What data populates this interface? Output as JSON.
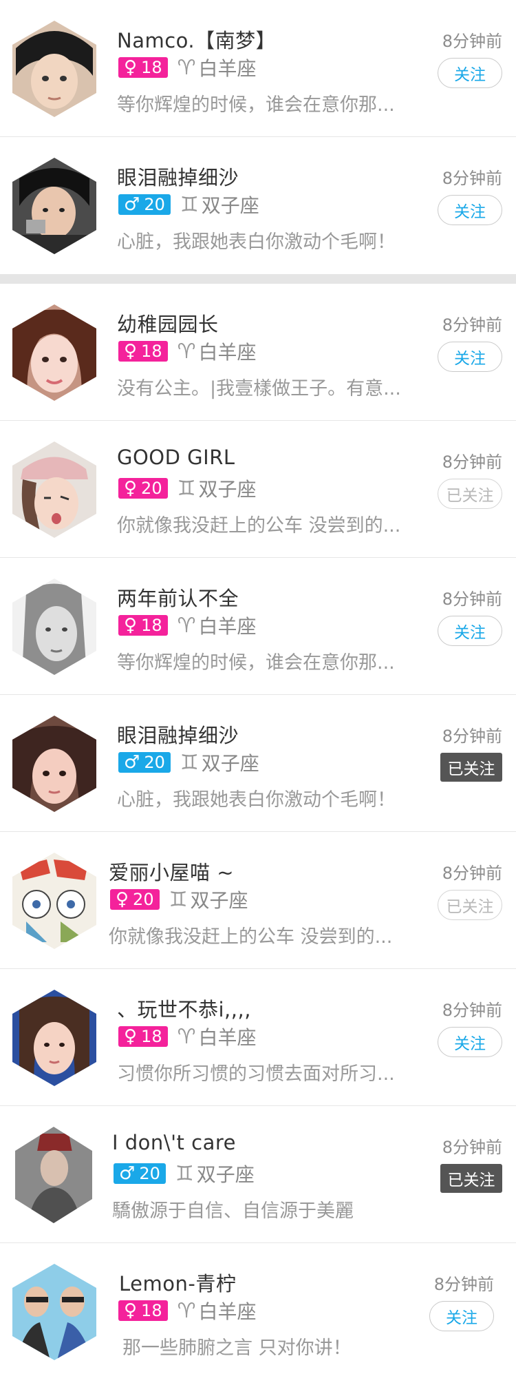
{
  "items": [
    {
      "name": "Namco.【南梦】",
      "gender_symbol": "♀",
      "age": "18",
      "zodiac_symbol": "♈",
      "zodiac": "白羊座",
      "desc": "等你辉煌的时候，谁会在意你那...",
      "time": "8分钟前",
      "follow": "关注"
    },
    {
      "name": "眼泪融掉细沙",
      "gender_symbol": "♂",
      "age": "20",
      "zodiac_symbol": "♊",
      "zodiac": "双子座",
      "desc": "心脏，我跟她表白你激动个毛啊！",
      "time": "8分钟前",
      "follow": "关注"
    },
    {
      "name": "幼稚园园长",
      "gender_symbol": "♀",
      "age": "18",
      "zodiac_symbol": "♈",
      "zodiac": "白羊座",
      "desc": "没有公主。|我壹樣做王子。有意...",
      "time": "8分钟前",
      "follow": "关注"
    },
    {
      "name": "GOOD GIRL",
      "gender_symbol": "♀",
      "age": "20",
      "zodiac_symbol": "♊",
      "zodiac": "双子座",
      "desc": "你就像我没赶上的公车 没尝到的...",
      "time": "8分钟前",
      "follow": "已关注"
    },
    {
      "name": "两年前认不全",
      "gender_symbol": "♀",
      "age": "18",
      "zodiac_symbol": "♈",
      "zodiac": "白羊座",
      "desc": "等你辉煌的时候，谁会在意你那...",
      "time": "8分钟前",
      "follow": "关注"
    },
    {
      "name": "眼泪融掉细沙",
      "gender_symbol": "♂",
      "age": "20",
      "zodiac_symbol": "♊",
      "zodiac": "双子座",
      "desc": "心脏，我跟她表白你激动个毛啊！",
      "time": "8分钟前",
      "follow": "已关注"
    },
    {
      "name": "爱丽小屋喵 ~",
      "gender_symbol": "♀",
      "age": "20",
      "zodiac_symbol": "♊",
      "zodiac": "双子座",
      "desc": "你就像我没赶上的公车 没尝到的...",
      "time": "8分钟前",
      "follow": "已关注"
    },
    {
      "name": "、玩世不恭i,,,,",
      "gender_symbol": "♀",
      "age": "18",
      "zodiac_symbol": "♈",
      "zodiac": "白羊座",
      "desc": "习惯你所习惯的习惯去面对所习...",
      "time": "8分钟前",
      "follow": "关注"
    },
    {
      "name": "I don\\'t care",
      "gender_symbol": "♂",
      "age": "20",
      "zodiac_symbol": "♊",
      "zodiac": "双子座",
      "desc": "驕傲源于自信、自信源于美麗",
      "time": "8分钟前",
      "follow": "已关注"
    },
    {
      "name": "Lemon-青柠",
      "gender_symbol": "♀",
      "age": "18",
      "zodiac_symbol": "♈",
      "zodiac": "白羊座",
      "desc": "那一些肺腑之言 只对你讲！",
      "time": "8分钟前",
      "follow": "关注"
    }
  ],
  "colors": {
    "female_badge": "#f4229b",
    "male_badge": "#1aa8e8",
    "follow_text": "#1aa8e8",
    "followed_dark_bg": "#555555",
    "divider": "#e6e6e6",
    "section_gap": "#e5e5e5"
  }
}
